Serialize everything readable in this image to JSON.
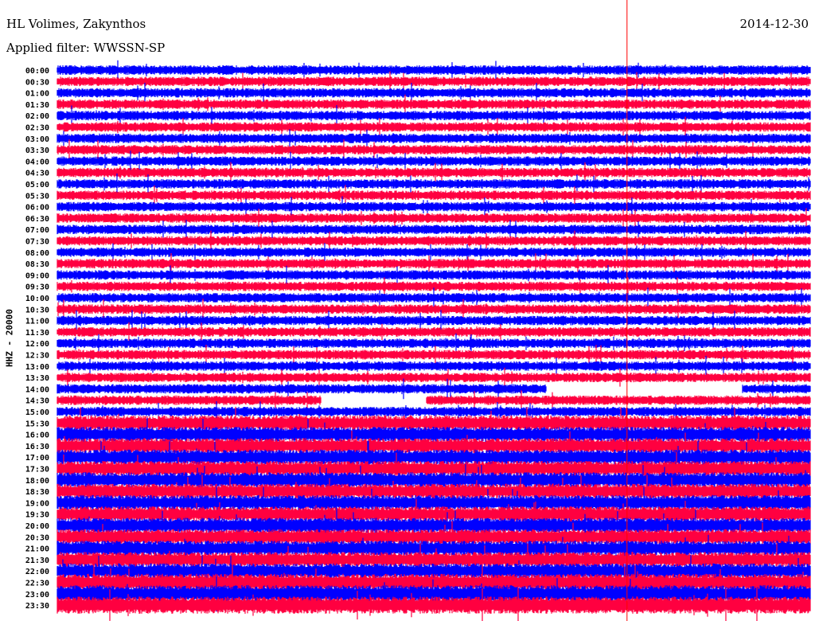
{
  "header": {
    "station": "HL Volimes, Zakynthos",
    "filter": "Applied filter: WWSSN-SP",
    "date": "2014-12-30"
  },
  "chart_data": {
    "type": "line",
    "title": "HL Volimes, Zakynthos",
    "ylabel": "HHZ - 20000",
    "row_labels": [
      "00:00",
      "00:30",
      "01:00",
      "01:30",
      "02:00",
      "02:30",
      "03:00",
      "03:30",
      "04:00",
      "04:30",
      "05:00",
      "05:30",
      "06:00",
      "06:30",
      "07:00",
      "07:30",
      "08:00",
      "08:30",
      "09:00",
      "09:30",
      "10:00",
      "10:30",
      "11:00",
      "11:30",
      "12:00",
      "12:30",
      "13:00",
      "13:30",
      "14:00",
      "14:30",
      "15:00",
      "15:30",
      "16:00",
      "16:30",
      "17:00",
      "17:30",
      "18:00",
      "18:30",
      "19:00",
      "19:30",
      "20:00",
      "20:30",
      "21:00",
      "21:30",
      "22:00",
      "22:30",
      "23:00",
      "23:30"
    ],
    "row_minutes": 30,
    "series_colors": [
      "#0000ff",
      "#ff0040"
    ],
    "marker_color": "#ff0000",
    "gaps": [
      {
        "row": "14:00",
        "from_min": 19.5,
        "to_min": 27.3
      },
      {
        "row": "14:30",
        "from_min": 10.5,
        "to_min": 14.7
      }
    ],
    "marker_minute": 22.7
  }
}
